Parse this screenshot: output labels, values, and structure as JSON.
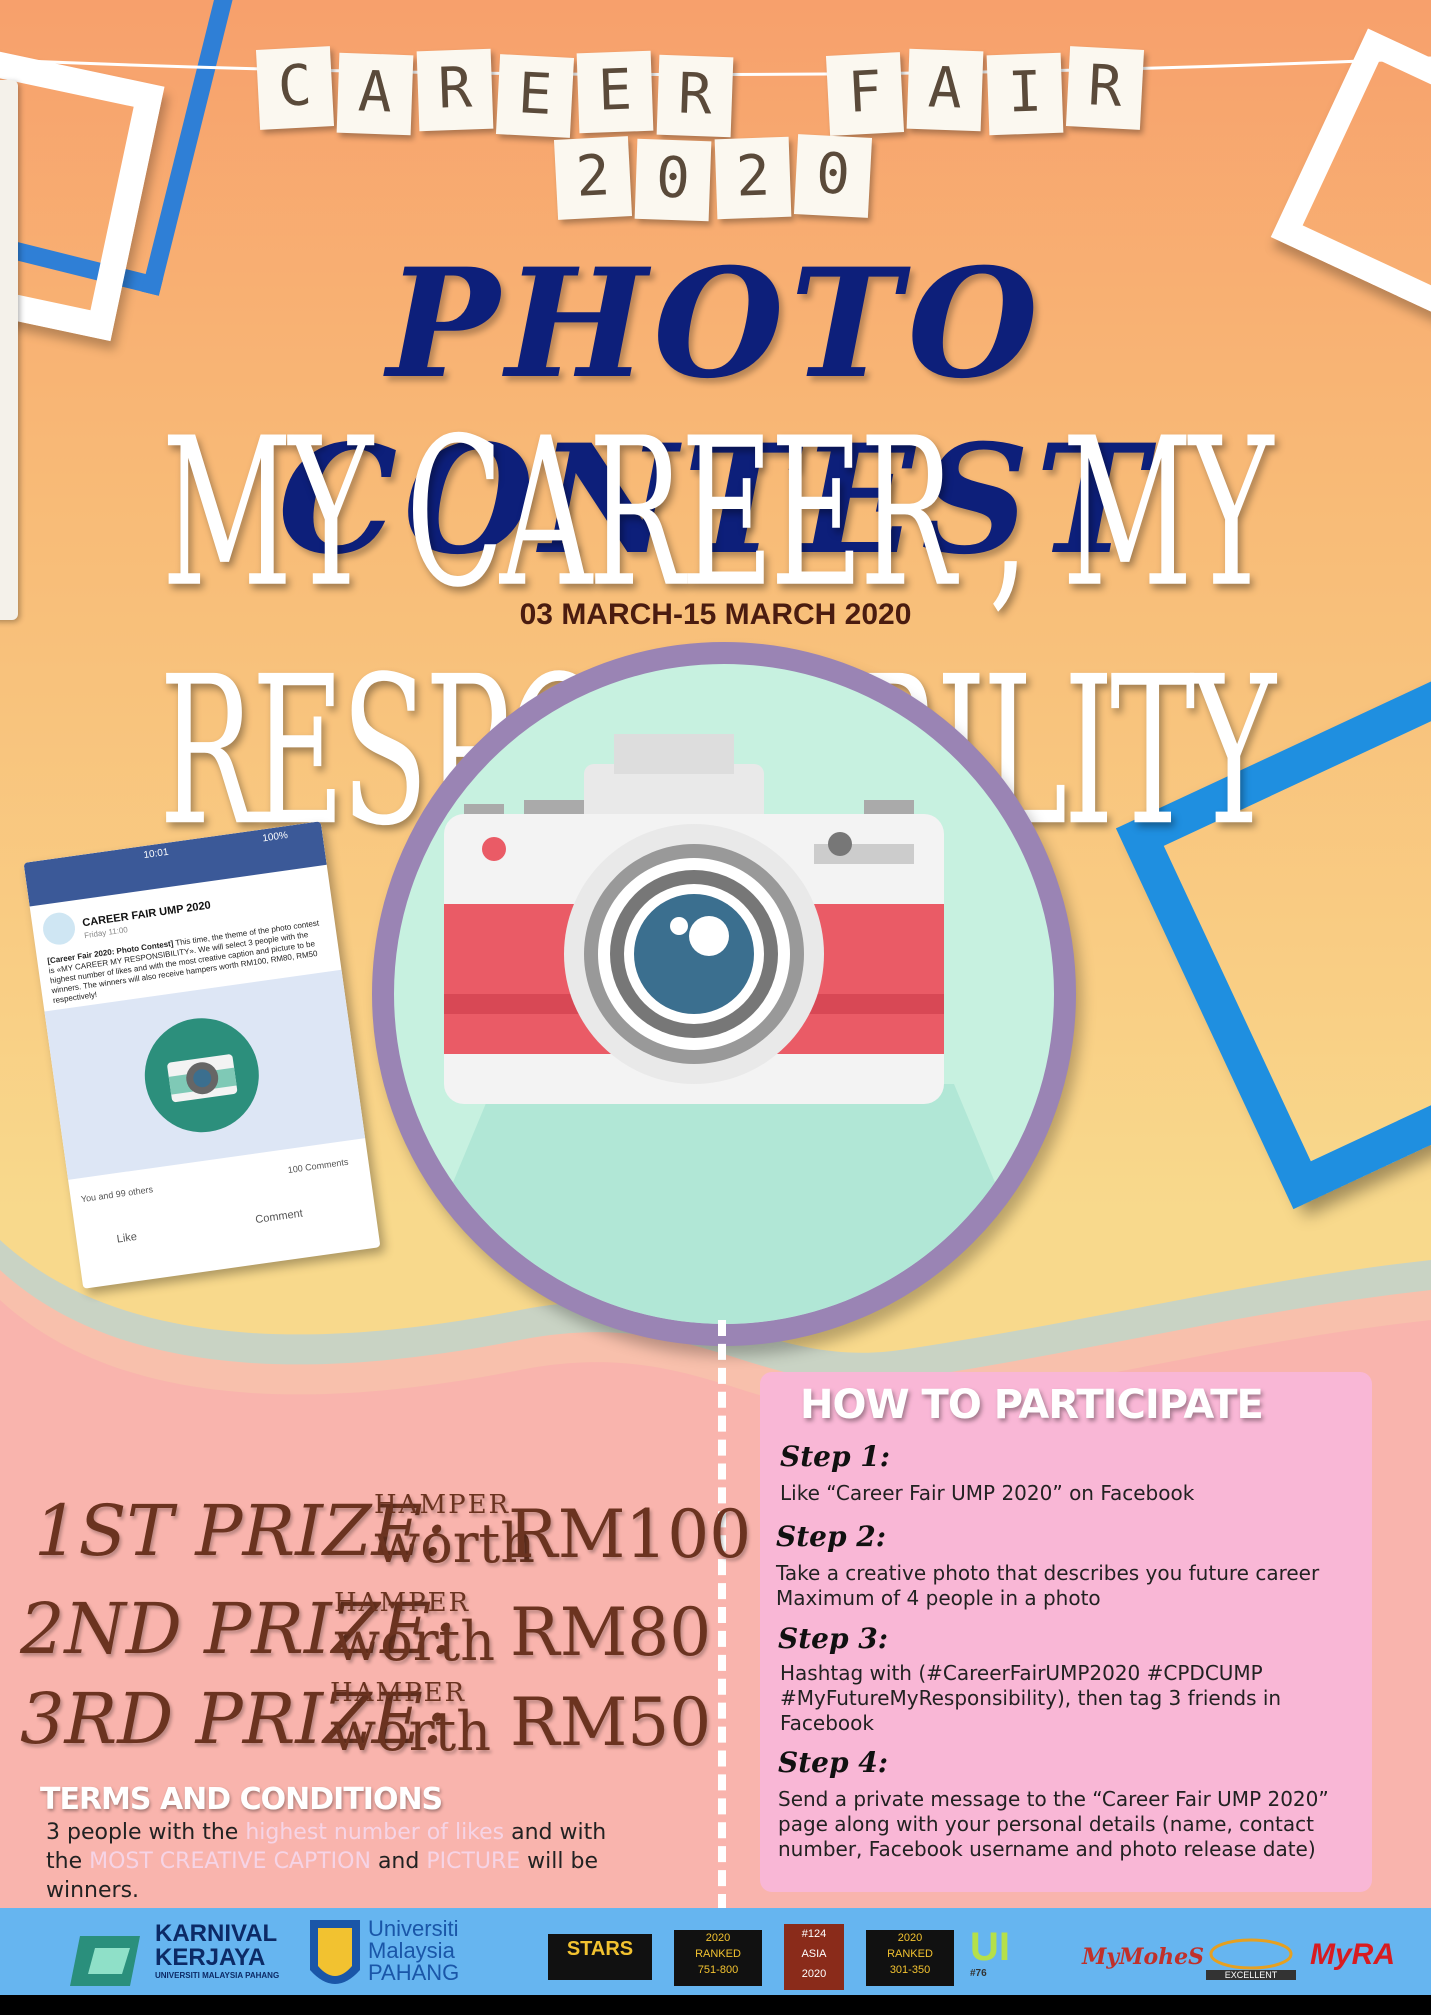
{
  "bunting": {
    "line1": [
      "C",
      "A",
      "R",
      "E",
      "E",
      "R",
      "F",
      "A",
      "I",
      "R"
    ],
    "line2": [
      "2",
      "0",
      "2",
      "0"
    ]
  },
  "title": "PHOTO CONTEST",
  "subtitle": "MY CAREER , MY RESPONSIBILITY",
  "date": "03 MARCH-15 MARCH 2020",
  "phone": {
    "time": "10:01",
    "battery": "100%",
    "page_name": "CAREER FAIR UMP 2020",
    "post_meta": "Friday 11:00",
    "post_title": "[Career Fair 2020: Photo Contest]",
    "post_body": "This time, the theme of the photo contest is «MY CAREER MY RESPONSIBILITY». We will select 3 people with the highest number of likes and with the most creative caption and picture to be winners. The winners will also receive hampers worth RM100, RM80, RM50 respectively!",
    "reactions": "You and 99 others",
    "comments_count": "100 Comments",
    "like": "Like",
    "comment": "Comment"
  },
  "prizes": [
    {
      "rank": "1ST PRIZE:",
      "hamper": "HAMPER",
      "worth": "worth",
      "amount": "RM100"
    },
    {
      "rank": "2ND PRIZE:",
      "hamper": "HAMPER",
      "worth": "worth",
      "amount": "RM80"
    },
    {
      "rank": "3RD PRIZE:",
      "hamper": "HAMPER",
      "worth": "worth",
      "amount": "RM50"
    }
  ],
  "terms": {
    "title": "TERMS AND CONDITIONS",
    "part1": "3 people with the ",
    "hl1": "highest number of likes",
    "part2": " and with the ",
    "hl2": "MOST CREATIVE CAPTION",
    "part3": " and ",
    "hl3": "PICTURE",
    "part4": " will be winners."
  },
  "how": {
    "title": "HOW TO PARTICIPATE",
    "steps": [
      {
        "label": "Step 1:",
        "text": "Like “Career Fair UMP 2020” on Facebook"
      },
      {
        "label": "Step 2:",
        "text": "Take a creative photo that describes you future career Maximum of 4 people in a photo"
      },
      {
        "label": "Step 3:",
        "text": " Hashtag with (#CareerFairUMP2020 #CPDCUMP #MyFutureMyResponsibility), then tag 3 friends in Facebook"
      },
      {
        "label": "Step 4:",
        "text": "Send a private message to the “Career Fair UMP 2020” page along with your personal details (name, contact number, Facebook username and photo release date)"
      }
    ]
  },
  "footer": {
    "karnival1": "KARNIVAL",
    "karnival2": "KERJAYA",
    "karnival3": "UNIVERSITI MALAYSIA PAHANG",
    "ump1": "Universiti",
    "ump2": "Malaysia",
    "ump3": "PAHANG",
    "stars": "STARS",
    "ranked1": "2020",
    "ranked1b": "RANKED",
    "ranked1c": "751-800",
    "asia1": "#124",
    "asia2": "ASIA",
    "asia3": "2020",
    "ranked2": "2020",
    "ranked2b": "RANKED",
    "ranked2c": "301-350",
    "ui": "UI",
    "uib": "#76",
    "mymohes": "MyMoheS",
    "excellent": "EXCELLENT",
    "myra": "MyRA"
  },
  "colors": {
    "title": "#0d1f7a",
    "prize": "#6b3320",
    "howbox": "#f9b7d6",
    "footer": "#66b5f0",
    "frame_blue": "#1f8fe0",
    "circle_border": "#9a84b4"
  }
}
